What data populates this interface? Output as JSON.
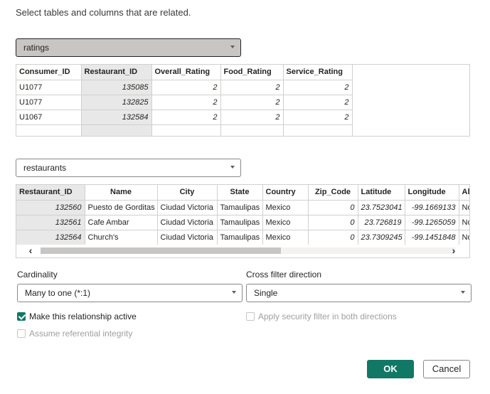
{
  "intro": "Select tables and columns that are related.",
  "table1": {
    "selected": "ratings",
    "columns": [
      "Consumer_ID",
      "Restaurant_ID",
      "Overall_Rating",
      "Food_Rating",
      "Service_Rating"
    ],
    "rows": [
      [
        "U1077",
        "135085",
        "2",
        "2",
        "2"
      ],
      [
        "U1077",
        "132825",
        "2",
        "2",
        "2"
      ],
      [
        "U1067",
        "132584",
        "2",
        "2",
        "2"
      ]
    ]
  },
  "table2": {
    "selected": "restaurants",
    "columns": [
      "Restaurant_ID",
      "Name",
      "City",
      "State",
      "Country",
      "Zip_Code",
      "Latitude",
      "Longitude",
      "Al"
    ],
    "rows": [
      [
        "132560",
        "Puesto de Gorditas",
        "Ciudad Victoria",
        "Tamaulipas",
        "Mexico",
        "0",
        "23.7523041",
        "-99.1669133",
        "No"
      ],
      [
        "132561",
        "Cafe Ambar",
        "Ciudad Victoria",
        "Tamaulipas",
        "Mexico",
        "0",
        "23.726819",
        "-99.1265059",
        "No"
      ],
      [
        "132564",
        "Church's",
        "Ciudad Victoria",
        "Tamaulipas",
        "Mexico",
        "0",
        "23.7309245",
        "-99.1451848",
        "No"
      ]
    ]
  },
  "cardinality": {
    "label": "Cardinality",
    "value": "Many to one (*:1)"
  },
  "cross_filter": {
    "label": "Cross filter direction",
    "value": "Single"
  },
  "options": {
    "active": "Make this relationship active",
    "security": "Apply security filter in both directions",
    "referential": "Assume referential integrity"
  },
  "buttons": {
    "ok": "OK",
    "cancel": "Cancel"
  },
  "colors": {
    "accent": "#117865",
    "highlight": "#e8e8e8"
  }
}
